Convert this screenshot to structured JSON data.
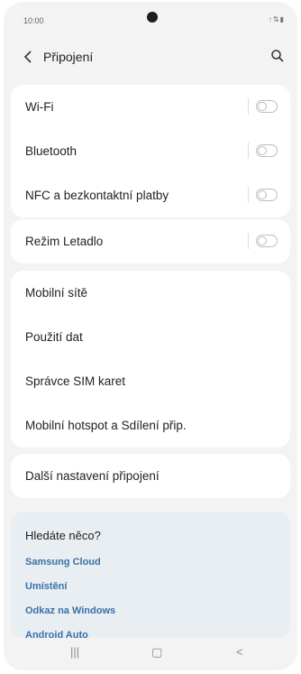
{
  "status_bar": {
    "time": "10:00",
    "icons": "↑⇅▮"
  },
  "header": {
    "title": "Připojení",
    "back_icon": "chevron-left-icon",
    "search_icon": "search-icon"
  },
  "group1": [
    {
      "label": "Wi-Fi",
      "toggle": false
    },
    {
      "label": "Bluetooth",
      "toggle": false
    },
    {
      "label": "NFC a bezkontaktní platby",
      "toggle": false
    }
  ],
  "group2": [
    {
      "label": "Režim Letadlo",
      "toggle": false
    }
  ],
  "group3": [
    {
      "label": "Mobilní sítě"
    },
    {
      "label": "Použití dat"
    },
    {
      "label": "Správce SIM karet"
    },
    {
      "label": "Mobilní hotspot a Sdílení přip."
    }
  ],
  "group4": [
    {
      "label": "Další nastavení připojení"
    }
  ],
  "suggestions": {
    "title": "Hledáte něco?",
    "links": [
      "Samsung Cloud",
      "Umístění",
      "Odkaz na Windows",
      "Android Auto"
    ]
  },
  "navbar": {
    "recent": "|||",
    "home": "▢",
    "back": "<"
  },
  "colors": {
    "background": "#f3f3f3",
    "card": "#ffffff",
    "suggest_bg": "#e8eef2",
    "link": "#3a71a8"
  }
}
